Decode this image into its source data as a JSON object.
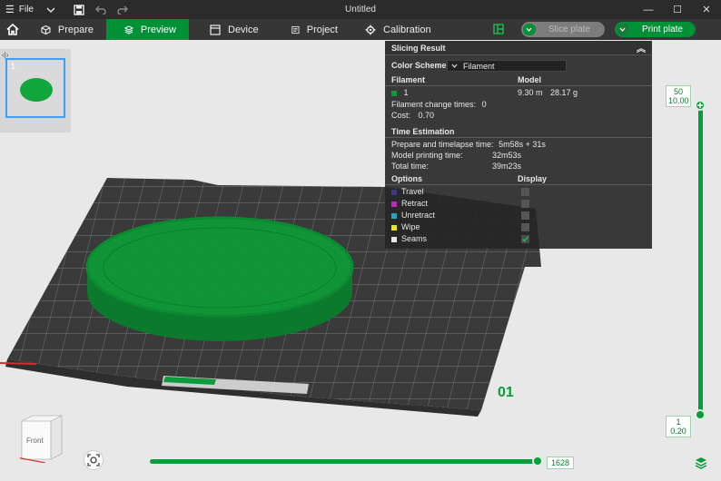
{
  "titlebar": {
    "file_label": "File",
    "title": "Untitled",
    "minimize": "—",
    "maximize": "☐",
    "close": "✕"
  },
  "nav": {
    "tabs": [
      {
        "label": "Prepare",
        "icon": "cube-icon",
        "active": false
      },
      {
        "label": "Preview",
        "icon": "layers-icon",
        "active": true
      },
      {
        "label": "Device",
        "icon": "device-icon",
        "active": false
      },
      {
        "label": "Project",
        "icon": "project-icon",
        "active": false
      },
      {
        "label": "Calibration",
        "icon": "calibration-icon",
        "active": false
      }
    ],
    "slice_label": "Slice plate",
    "print_label": "Print plate"
  },
  "plate_thumbnail": {
    "number": "1"
  },
  "slicing_result": {
    "title": "Slicing Result",
    "color_scheme_label": "Color Scheme",
    "color_scheme_value": "Filament",
    "filament_header": "Filament",
    "model_header": "Model",
    "filament_id": "1",
    "filament_color": "#0a9b3a",
    "model_length": "9.30 m",
    "model_weight": "28.17 g",
    "change_times_label": "Filament change times:",
    "change_times_value": "0",
    "cost_label": "Cost:",
    "cost_value": "0.70",
    "time_header": "Time Estimation",
    "prepare_label": "Prepare and timelapse time:",
    "prepare_value": "5m58s + 31s",
    "model_time_label": "Model printing time:",
    "model_time_value": "32m53s",
    "total_label": "Total time:",
    "total_value": "39m23s",
    "options_header": "Options",
    "display_header": "Display",
    "options": [
      {
        "label": "Travel",
        "color": "#3a3a8a",
        "checked": false
      },
      {
        "label": "Retract",
        "color": "#c026c0",
        "checked": false
      },
      {
        "label": "Unretract",
        "color": "#2aa0c8",
        "checked": false
      },
      {
        "label": "Wipe",
        "color": "#e8e820",
        "checked": false
      },
      {
        "label": "Seams",
        "color": "#e8e8e8",
        "checked": true
      }
    ]
  },
  "layer_slider": {
    "top_layer": "50",
    "top_height": "10.00",
    "bottom_layer": "1",
    "bottom_height": "0.20"
  },
  "move_slider": {
    "value": "1628"
  },
  "view_cube": {
    "face": "Front"
  },
  "plate_label": "01"
}
